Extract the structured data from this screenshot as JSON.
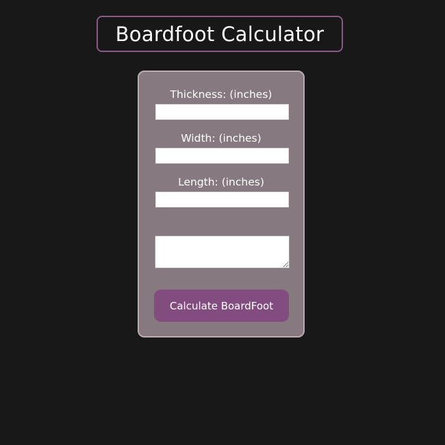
{
  "header": {
    "title": "Boardfoot Calculator"
  },
  "form": {
    "thickness": {
      "label": "Thickness: (inches)",
      "value": "",
      "placeholder": ""
    },
    "width": {
      "label": "Width: (inches)",
      "value": "",
      "placeholder": ""
    },
    "length": {
      "label": "Length: (inches)",
      "value": "",
      "placeholder": ""
    },
    "result": {
      "value": ""
    },
    "calculate_label": "Calculate BoardFoot"
  },
  "colors": {
    "background": "#181818",
    "card": "#86797f",
    "card_border": "#b9adb3",
    "title_border": "#8a5a86",
    "button": "#824c7f",
    "text": "#ffffff"
  }
}
